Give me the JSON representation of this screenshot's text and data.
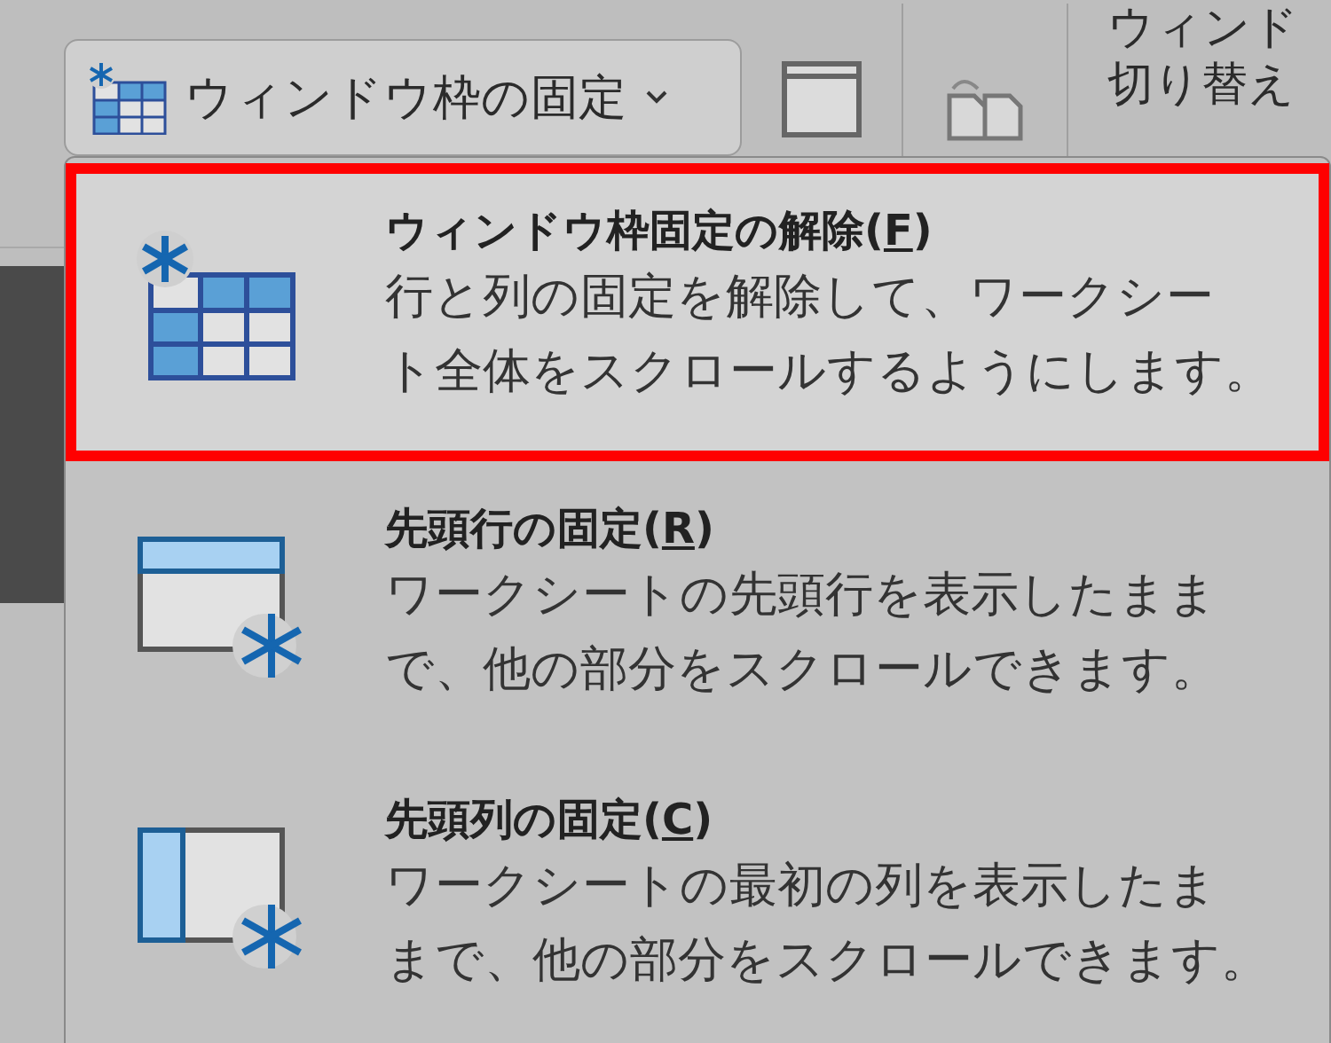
{
  "ribbon": {
    "freeze_button": {
      "label": "ウィンドウ枠の固定",
      "expanded": true
    },
    "switch_window_partial": "ウィンド",
    "switch_window": "切り替え"
  },
  "menu": {
    "items": [
      {
        "kind": "unfreeze",
        "title": "ウィンドウ枠固定の解除(",
        "hotkey": "F",
        "title_end": ")",
        "description_lines": [
          "行と列の固定を解除して、ワークシー",
          "ト全体をスクロールするようにします。"
        ],
        "selected": true
      },
      {
        "kind": "top_row",
        "title": "先頭行の固定(",
        "hotkey": "R",
        "title_end": ")",
        "description_lines": [
          "ワークシートの先頭行を表示したまま",
          "で、他の部分をスクロールできます。"
        ],
        "selected": false
      },
      {
        "kind": "first_column",
        "title": "先頭列の固定(",
        "hotkey": "C",
        "title_end": ")",
        "description_lines": [
          "ワークシートの最初の列を表示したま",
          "まで、他の部分をスクロールできます。"
        ],
        "selected": false
      }
    ]
  }
}
